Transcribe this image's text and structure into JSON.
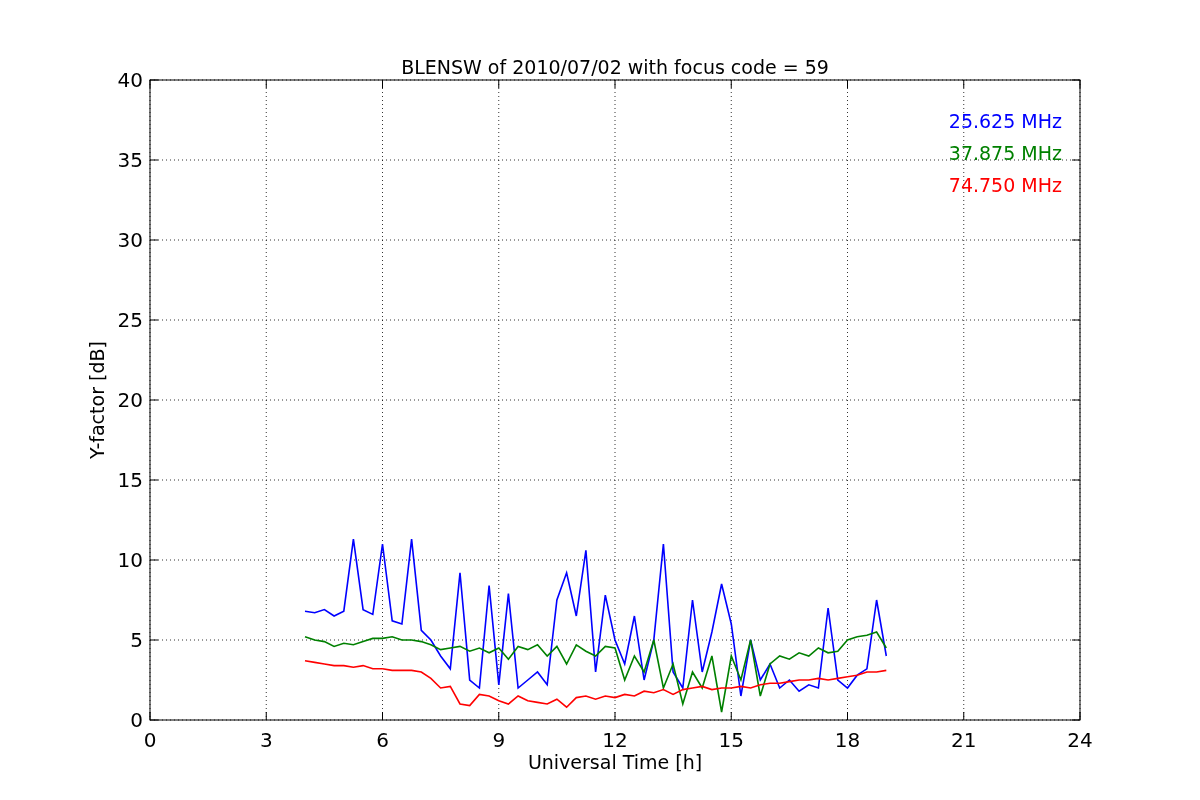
{
  "chart_data": {
    "type": "line",
    "title": "BLENSW of 2010/07/02 with focus code = 59",
    "xlabel": "Universal Time [h]",
    "ylabel": "Y-factor [dB]",
    "x": [
      4,
      4.25,
      4.5,
      4.75,
      5,
      5.25,
      5.5,
      5.75,
      6,
      6.25,
      6.5,
      6.75,
      7,
      7.25,
      7.5,
      7.75,
      8,
      8.25,
      8.5,
      8.75,
      9,
      9.25,
      9.5,
      9.75,
      10,
      10.25,
      10.5,
      10.75,
      11,
      11.25,
      11.5,
      11.75,
      12,
      12.25,
      12.5,
      12.75,
      13,
      13.25,
      13.5,
      13.75,
      14,
      14.25,
      14.5,
      14.75,
      15,
      15.25,
      15.5,
      15.75,
      16,
      16.25,
      16.5,
      16.75,
      17,
      17.25,
      17.5,
      17.75,
      18,
      18.25,
      18.5,
      18.75,
      19
    ],
    "series": [
      {
        "name": "25.625 MHz",
        "color": "#0000ff",
        "values": [
          6.8,
          6.7,
          6.9,
          6.5,
          6.8,
          11.3,
          6.9,
          6.6,
          11,
          6.2,
          6.0,
          11.3,
          5.6,
          5.0,
          4.0,
          3.2,
          9.2,
          2.5,
          2.0,
          8.4,
          2.2,
          7.9,
          2.0,
          2.5,
          3.0,
          2.2,
          7.5,
          9.2,
          6.5,
          10.6,
          3.0,
          7.8,
          5.0,
          3.5,
          6.5,
          2.5,
          5.0,
          11.0,
          3.0,
          2.0,
          7.5,
          3.0,
          5.5,
          8.5,
          6.0,
          1.5,
          5.0,
          2.5,
          3.5,
          2.0,
          2.5,
          1.8,
          2.2,
          2.0,
          7.0,
          2.5,
          2.0,
          2.8,
          3.2,
          7.5,
          4.0
        ]
      },
      {
        "name": "37.875 MHz",
        "color": "#008000",
        "values": [
          5.2,
          5.0,
          4.9,
          4.6,
          4.8,
          4.7,
          4.9,
          5.1,
          5.1,
          5.2,
          5.0,
          5.0,
          4.9,
          4.7,
          4.4,
          4.5,
          4.6,
          4.3,
          4.5,
          4.2,
          4.5,
          3.8,
          4.6,
          4.4,
          4.7,
          4.0,
          4.6,
          3.5,
          4.7,
          4.3,
          4.0,
          4.6,
          4.5,
          2.5,
          4.0,
          3.0,
          5.0,
          2.0,
          3.5,
          1.0,
          3.0,
          2.0,
          4.0,
          0.5,
          4.0,
          2.5,
          5.0,
          1.5,
          3.5,
          4.0,
          3.8,
          4.2,
          4.0,
          4.5,
          4.2,
          4.3,
          5.0,
          5.2,
          5.3,
          5.5,
          4.5
        ]
      },
      {
        "name": "74.750 MHz",
        "color": "#ff0000",
        "values": [
          3.7,
          3.6,
          3.5,
          3.4,
          3.4,
          3.3,
          3.4,
          3.2,
          3.2,
          3.1,
          3.1,
          3.1,
          3.0,
          2.6,
          2.0,
          2.1,
          1.0,
          0.9,
          1.6,
          1.5,
          1.2,
          1.0,
          1.5,
          1.2,
          1.1,
          1.0,
          1.3,
          0.8,
          1.4,
          1.5,
          1.3,
          1.5,
          1.4,
          1.6,
          1.5,
          1.8,
          1.7,
          1.9,
          1.6,
          1.9,
          2.0,
          2.1,
          1.9,
          2.0,
          2.0,
          2.1,
          2.0,
          2.2,
          2.3,
          2.3,
          2.4,
          2.5,
          2.5,
          2.6,
          2.5,
          2.6,
          2.7,
          2.8,
          3.0,
          3.0,
          3.1
        ]
      }
    ],
    "xlim": [
      0,
      24
    ],
    "ylim": [
      0,
      40
    ],
    "xticks": [
      0,
      3,
      6,
      9,
      12,
      15,
      18,
      21,
      24
    ],
    "yticks": [
      0,
      5,
      10,
      15,
      20,
      25,
      30,
      35,
      40
    ],
    "grid": true
  }
}
